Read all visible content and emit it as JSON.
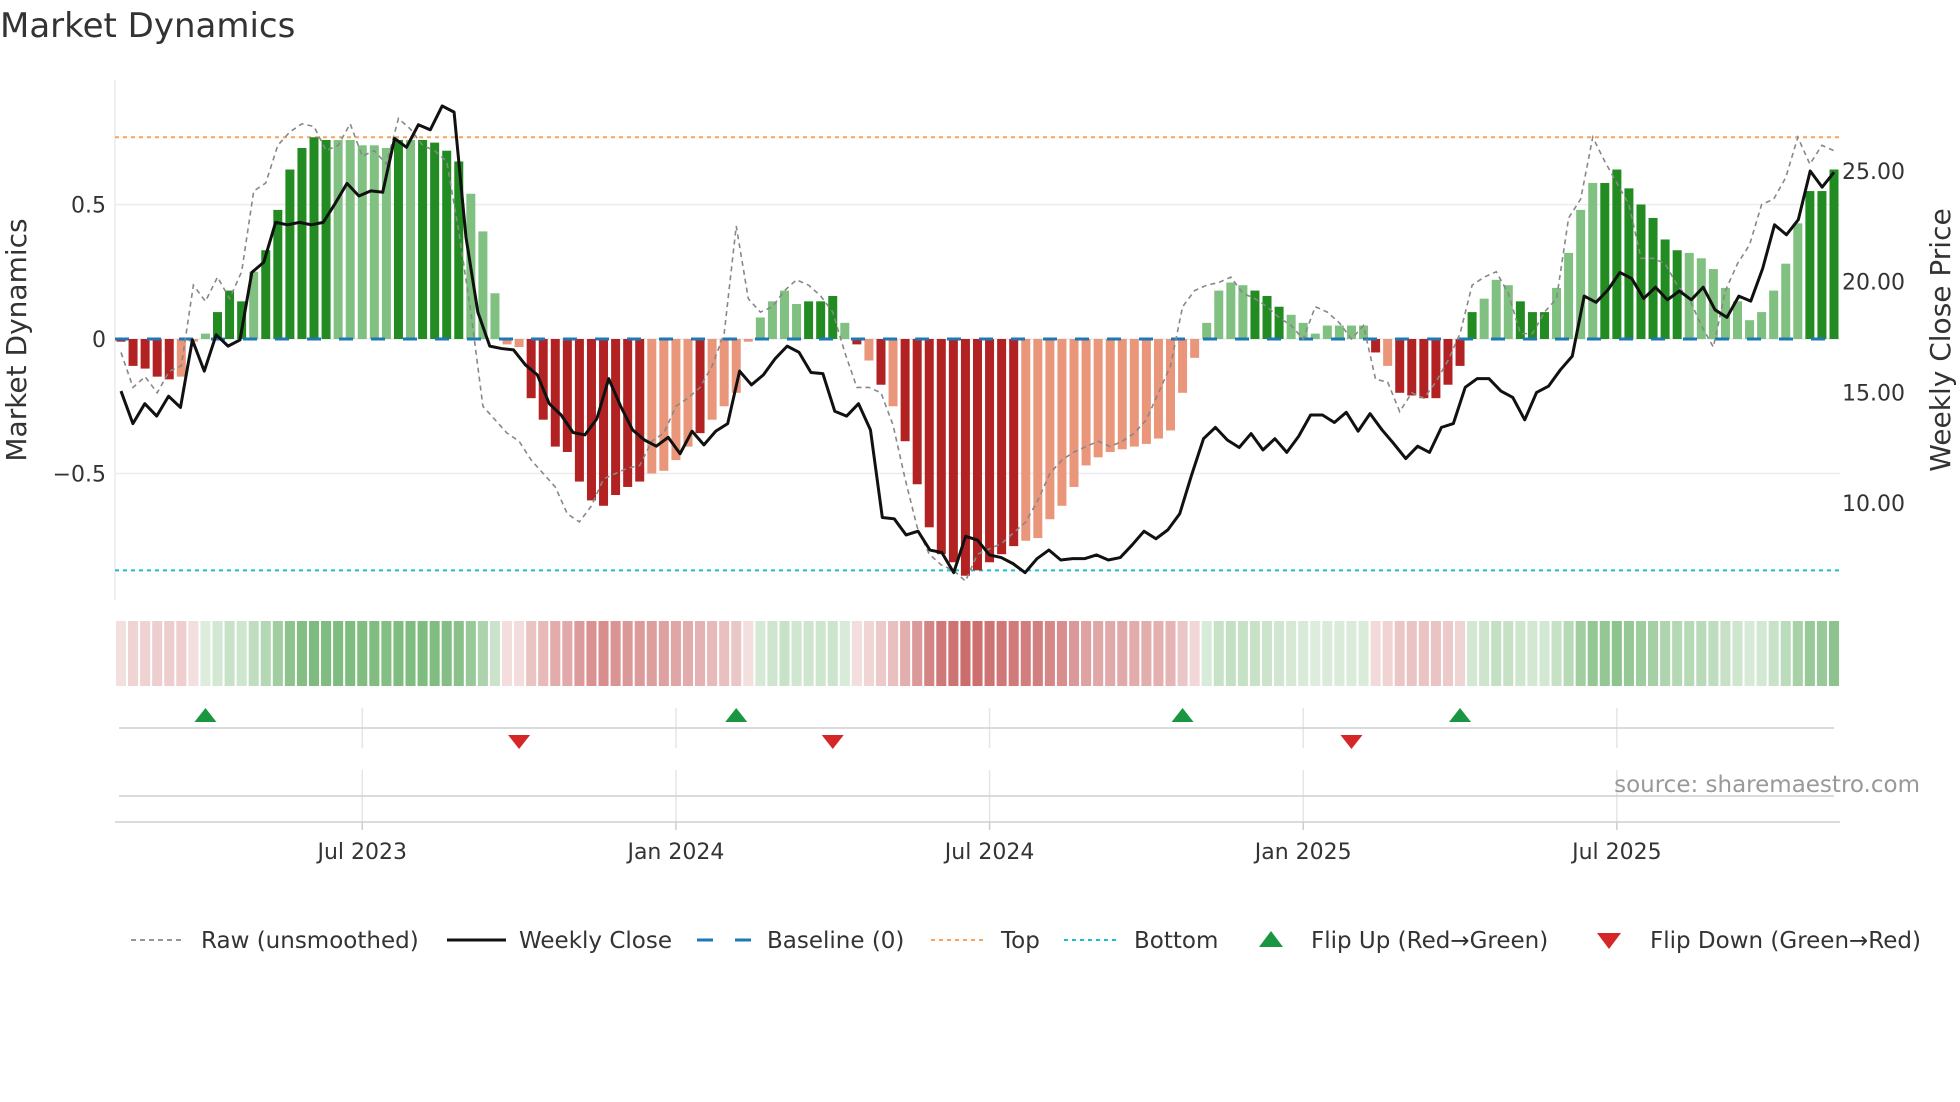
{
  "chart_data": {
    "type": "bar",
    "title": "Market Dynamics",
    "ylabel": "Market Dynamics",
    "y2label": "Weekly Close Price",
    "ylim": [
      -0.97,
      0.96
    ],
    "y2lim": [
      5.6,
      31.0
    ],
    "yticks": [
      {
        "v": 0.5,
        "label": "0.5"
      },
      {
        "v": 0,
        "label": "0"
      },
      {
        "v": -0.5,
        "label": "−0.5"
      }
    ],
    "y2ticks": [
      {
        "v": 25,
        "label": "25.00"
      },
      {
        "v": 20,
        "label": "20.00"
      },
      {
        "v": 15,
        "label": "15.00"
      },
      {
        "v": 10,
        "label": "10.00"
      }
    ],
    "xticks": [
      {
        "week": 20,
        "label": "Jul 2023"
      },
      {
        "week": 46,
        "label": "Jan 2024"
      },
      {
        "week": 72,
        "label": "Jul 2024"
      },
      {
        "week": 98,
        "label": "Jan 2025"
      },
      {
        "week": 124,
        "label": "Jul 2025"
      }
    ],
    "top_level": 0.75,
    "bottom_level": -0.86,
    "baseline": 0,
    "source": "source: sharemaestro.com",
    "colors": {
      "green_dark": "#228b22",
      "green_light": "#80c080",
      "red_dark": "#b22222",
      "red_light": "#e9967a",
      "baseline": "#1f77b4",
      "top": "#f4a460",
      "bottom": "#17becf",
      "close": "#111111",
      "raw": "#888888",
      "flip_up": "#1a9641",
      "flip_down": "#d62728"
    },
    "bars": [
      -0.01,
      -0.1,
      -0.11,
      -0.14,
      -0.15,
      -0.14,
      -0.01,
      0.02,
      0.1,
      0.18,
      0.14,
      0.25,
      0.33,
      0.48,
      0.63,
      0.71,
      0.75,
      0.74,
      0.74,
      0.74,
      0.72,
      0.72,
      0.71,
      0.74,
      0.74,
      0.74,
      0.73,
      0.7,
      0.66,
      0.54,
      0.4,
      0.17,
      -0.02,
      -0.03,
      -0.22,
      -0.3,
      -0.4,
      -0.42,
      -0.53,
      -0.6,
      -0.62,
      -0.58,
      -0.55,
      -0.53,
      -0.5,
      -0.49,
      -0.45,
      -0.4,
      -0.35,
      -0.3,
      -0.25,
      -0.2,
      -0.01,
      0.08,
      0.14,
      0.18,
      0.13,
      0.14,
      0.14,
      0.16,
      0.06,
      -0.02,
      -0.08,
      -0.17,
      -0.25,
      -0.38,
      -0.54,
      -0.7,
      -0.8,
      -0.83,
      -0.88,
      -0.86,
      -0.83,
      -0.8,
      -0.77,
      -0.75,
      -0.74,
      -0.67,
      -0.62,
      -0.55,
      -0.47,
      -0.44,
      -0.42,
      -0.41,
      -0.4,
      -0.39,
      -0.37,
      -0.34,
      -0.2,
      -0.07,
      0.06,
      0.18,
      0.21,
      0.2,
      0.18,
      0.16,
      0.12,
      0.09,
      0.06,
      0.02,
      0.05,
      0.05,
      0.05,
      0.05,
      -0.05,
      -0.1,
      -0.2,
      -0.21,
      -0.22,
      -0.22,
      -0.17,
      -0.1,
      0.1,
      0.15,
      0.22,
      0.2,
      0.14,
      0.1,
      0.1,
      0.19,
      0.32,
      0.48,
      0.58,
      0.58,
      0.63,
      0.56,
      0.5,
      0.45,
      0.37,
      0.33,
      0.32,
      0.3,
      0.26,
      0.19,
      0.14,
      0.07,
      0.1,
      0.18,
      0.28,
      0.43,
      0.55,
      0.55,
      0.63
    ],
    "bar_shade": "dddddllldddlddddddllllldlddddlllllddddddddddlllldlllllllldddldldlddddddddddllllllllllllllllllldddllllllldldddddddllldddlllldddddddlllllllllldddddd",
    "raw": [
      -0.05,
      -0.18,
      -0.14,
      -0.2,
      -0.12,
      -0.1,
      0.2,
      0.14,
      0.23,
      0.15,
      0.25,
      0.55,
      0.58,
      0.72,
      0.77,
      0.8,
      0.79,
      0.7,
      0.72,
      0.8,
      0.68,
      0.7,
      0.65,
      0.82,
      0.78,
      0.72,
      0.7,
      0.66,
      0.4,
      0.1,
      -0.25,
      -0.3,
      -0.35,
      -0.38,
      -0.45,
      -0.5,
      -0.55,
      -0.65,
      -0.68,
      -0.62,
      -0.52,
      -0.5,
      -0.48,
      -0.47,
      -0.38,
      -0.35,
      -0.25,
      -0.22,
      -0.18,
      -0.1,
      0.02,
      0.42,
      0.15,
      0.1,
      0.12,
      0.18,
      0.22,
      0.2,
      0.16,
      0.1,
      -0.05,
      -0.18,
      -0.18,
      -0.2,
      -0.32,
      -0.52,
      -0.7,
      -0.8,
      -0.84,
      -0.86,
      -0.9,
      -0.8,
      -0.78,
      -0.76,
      -0.72,
      -0.68,
      -0.6,
      -0.5,
      -0.45,
      -0.42,
      -0.4,
      -0.38,
      -0.4,
      -0.38,
      -0.35,
      -0.3,
      -0.2,
      -0.1,
      0.12,
      0.18,
      0.2,
      0.21,
      0.23,
      0.17,
      0.15,
      0.12,
      0.08,
      0.05,
      0.0,
      0.12,
      0.1,
      0.06,
      0.0,
      0.05,
      -0.15,
      -0.16,
      -0.27,
      -0.2,
      -0.22,
      -0.16,
      -0.08,
      0.02,
      0.2,
      0.23,
      0.25,
      0.17,
      0.02,
      0.02,
      0.1,
      0.15,
      0.45,
      0.52,
      0.75,
      0.66,
      0.58,
      0.5,
      0.3,
      0.3,
      0.28,
      0.2,
      0.15,
      0.05,
      -0.03,
      0.18,
      0.28,
      0.35,
      0.5,
      0.52,
      0.6,
      0.75,
      0.65,
      0.72,
      0.7
    ],
    "close": [
      15.06,
      13.59,
      14.49,
      13.93,
      14.83,
      14.32,
      17.37,
      15.96,
      17.6,
      17.09,
      17.37,
      20.42,
      20.88,
      22.68,
      22.57,
      22.68,
      22.57,
      22.68,
      23.53,
      24.44,
      23.87,
      24.1,
      24.04,
      26.47,
      26.07,
      27.09,
      26.86,
      27.94,
      27.66,
      22.01,
      18.62,
      17.09,
      16.98,
      16.92,
      16.24,
      15.79,
      14.49,
      13.98,
      13.19,
      13.08,
      13.81,
      15.62,
      14.38,
      13.31,
      12.85,
      12.57,
      12.97,
      12.23,
      13.25,
      12.63,
      13.25,
      13.59,
      15.96,
      15.34,
      15.79,
      16.53,
      17.09,
      16.81,
      15.9,
      15.85,
      14.15,
      13.93,
      14.49,
      13.31,
      9.35,
      9.29,
      8.56,
      8.73,
      7.88,
      7.77,
      6.86,
      8.5,
      8.33,
      7.66,
      7.54,
      7.26,
      6.86,
      7.49,
      7.88,
      7.43,
      7.49,
      7.49,
      7.66,
      7.43,
      7.54,
      8.11,
      8.73,
      8.39,
      8.79,
      9.52,
      11.27,
      12.91,
      13.42,
      12.85,
      12.51,
      13.14,
      12.4,
      12.91,
      12.29,
      13.02,
      13.98,
      13.98,
      13.64,
      14.1,
      13.25,
      14.04,
      13.31,
      12.68,
      12.01,
      12.57,
      12.29,
      13.42,
      13.59,
      15.23,
      15.62,
      15.62,
      15.06,
      14.77,
      13.76,
      15.0,
      15.28,
      16.02,
      16.64,
      19.35,
      19.07,
      19.63,
      20.42,
      20.14,
      19.24,
      19.75,
      19.18,
      19.58,
      19.18,
      19.75,
      18.73,
      18.39,
      19.35,
      19.12,
      20.59,
      22.57,
      22.12,
      22.8,
      25.0,
      24.27,
      24.94
    ],
    "flip_up": [
      7,
      51,
      88,
      111
    ],
    "flip_down": [
      33,
      59,
      102
    ],
    "legend": {
      "position": "bottom",
      "items": [
        {
          "label": "Raw (unsmoothed)",
          "kind": "raw"
        },
        {
          "label": "Weekly Close",
          "kind": "close"
        },
        {
          "label": "Baseline (0)",
          "kind": "baseline"
        },
        {
          "label": "Top",
          "kind": "top"
        },
        {
          "label": "Bottom",
          "kind": "bottom"
        },
        {
          "label": "Flip Up (Red→Green)",
          "kind": "up"
        },
        {
          "label": "Flip Down (Green→Red)",
          "kind": "down"
        }
      ]
    }
  }
}
